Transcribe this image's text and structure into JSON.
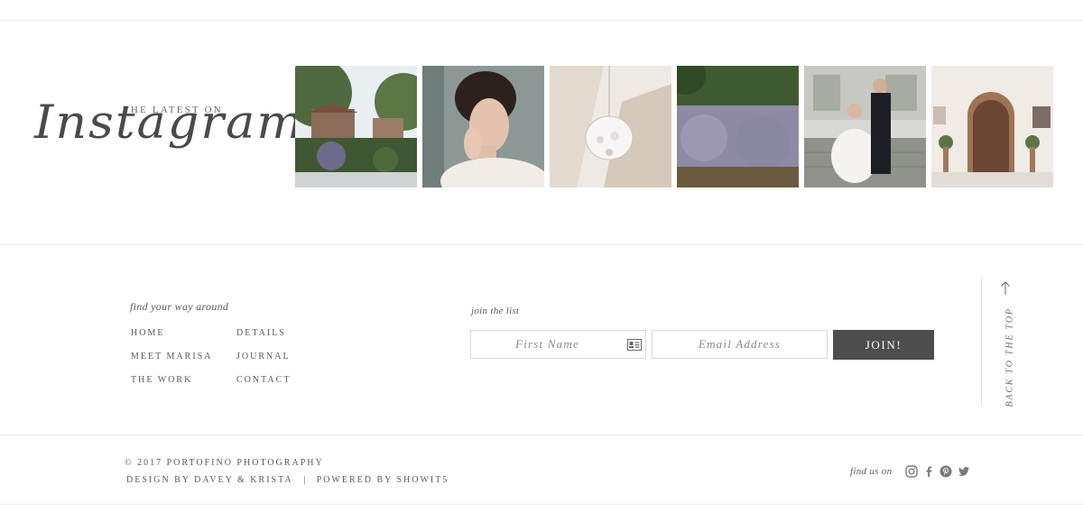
{
  "instagram": {
    "latest_label": "THE LATEST ON",
    "script_label": "Instagram",
    "photos": [
      {
        "icon": "garden-photo"
      },
      {
        "icon": "bride-portrait-photo"
      },
      {
        "icon": "chandelier-photo"
      },
      {
        "icon": "lavender-photo"
      },
      {
        "icon": "couple-stairs-photo"
      },
      {
        "icon": "villa-door-photo"
      }
    ]
  },
  "nav": {
    "heading": "find your way around",
    "links": [
      "HOME",
      "DETAILS",
      "MEET MARISA",
      "JOURNAL",
      "THE WORK",
      "CONTACT"
    ]
  },
  "newsletter": {
    "heading": "join the list",
    "first_name_placeholder": "First Name",
    "email_placeholder": "Email Address",
    "button_label": "JOIN!"
  },
  "back_to_top": "BACK TO THE TOP",
  "footer": {
    "copyright": "© 2017 PORTOFINO PHOTOGRAPHY",
    "design_by": "DESIGN BY DAVEY & KRISTA",
    "separator": "|",
    "powered_by": "POWERED BY SHOWIT5",
    "find_us": "find us on",
    "social": [
      "instagram-icon",
      "facebook-icon",
      "pinterest-icon",
      "twitter-icon"
    ]
  },
  "colors": {
    "text": "#5a5a5a",
    "button": "#4d4d4d",
    "divider": "#ececec"
  }
}
